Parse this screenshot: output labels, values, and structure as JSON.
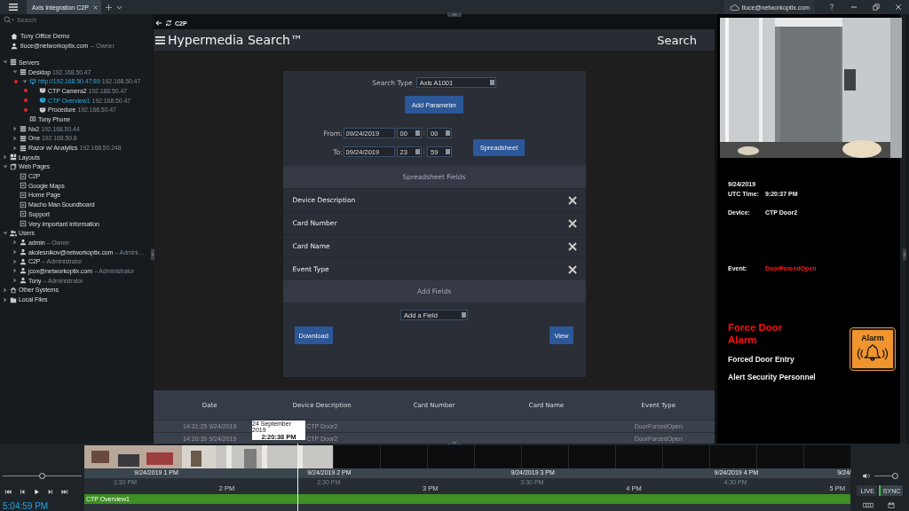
{
  "title_bar": {
    "tab": {
      "label": "Axis Integration C2P",
      "selected": true
    },
    "account": "tluce@networkoptix.com"
  },
  "sidebar": {
    "search_placeholder": "Search",
    "system": "Tony Office Demo",
    "user": {
      "name": "tluce@networkoptix.com",
      "role": "– Owner"
    },
    "tree": [
      {
        "label": "Servers",
        "kind": "servers",
        "expanded": true,
        "selected": false,
        "children": [
          {
            "label": "Desktop",
            "detail": "192.168.50.47",
            "kind": "server",
            "expanded": true,
            "selected": false,
            "children": [
              {
                "label": "http://192.168.50.47:89",
                "detail": "192.168.50.47",
                "kind": "webcam",
                "expanded": true,
                "recording": true,
                "selected": true,
                "children": [
                  {
                    "label": "CTP Camera2",
                    "detail": "192.168.50.47",
                    "kind": "camera",
                    "recording": true,
                    "selected": false
                  },
                  {
                    "label": "CTP Overview1",
                    "detail": "192.168.50.47",
                    "kind": "camera",
                    "recording": true,
                    "selected": true
                  },
                  {
                    "label": "Procedure",
                    "detail": "192.168.50.47",
                    "kind": "camera",
                    "recording": true,
                    "selected": false
                  }
                ]
              },
              {
                "label": "Tony Phone",
                "kind": "phone",
                "recording": false,
                "selected": false
              }
            ]
          },
          {
            "label": "Nx2",
            "detail": "192.168.50.44",
            "kind": "server",
            "expanded": false,
            "selected": false
          },
          {
            "label": "One",
            "detail": "192.168.50.8",
            "kind": "server",
            "expanded": false,
            "selected": false
          },
          {
            "label": "Razor w/ Analytics",
            "detail": "192.168.50.248",
            "kind": "server",
            "expanded": false,
            "selected": false
          }
        ]
      },
      {
        "label": "Layouts",
        "kind": "layouts",
        "expanded": false,
        "selected": false
      },
      {
        "label": "Web Pages",
        "kind": "webpages",
        "expanded": true,
        "selected": false,
        "children": [
          {
            "label": "C2P",
            "kind": "webpage",
            "selected": false
          },
          {
            "label": "Google Maps",
            "kind": "webpage",
            "selected": false
          },
          {
            "label": "Home Page",
            "kind": "webpage",
            "selected": false
          },
          {
            "label": "Macho Man Soundboard",
            "kind": "webpage",
            "selected": false
          },
          {
            "label": "Support",
            "kind": "webpage",
            "selected": false
          },
          {
            "label": "Very Important Information",
            "kind": "webpage",
            "selected": false
          }
        ]
      },
      {
        "label": "Users",
        "kind": "users",
        "expanded": true,
        "selected": false,
        "children": [
          {
            "label": "admin",
            "detail": "– Owner",
            "kind": "user",
            "expanded": false,
            "selected": false
          },
          {
            "label": "akolesnikov@networkoptix.com",
            "detail": "– Admini…",
            "kind": "user",
            "expanded": false,
            "selected": false
          },
          {
            "label": "C2P",
            "detail": "– Administrator",
            "kind": "user",
            "expanded": false,
            "selected": false
          },
          {
            "label": "jcox@networkoptix.com",
            "detail": "– Administrator",
            "kind": "user",
            "expanded": false,
            "selected": false
          },
          {
            "label": "Tony",
            "detail": "– Administrator",
            "kind": "user",
            "expanded": false,
            "selected": false
          }
        ]
      },
      {
        "label": "Other Systems",
        "kind": "systems",
        "expanded": false,
        "selected": false
      },
      {
        "label": "Local Files",
        "kind": "folder",
        "expanded": false,
        "selected": false
      }
    ]
  },
  "web_page": {
    "name": "C2P",
    "title": "Hypermedia Search™",
    "nav_label": "Search",
    "form": {
      "search_type_label": "Search Type",
      "search_type": "Axis A1001",
      "add_parameter": "Add Parameter",
      "ranges": [
        {
          "label": "From:",
          "date": "09/24/2019",
          "hour": "00",
          "separator": ":",
          "minute": "00"
        },
        {
          "label": "To:",
          "date": "09/24/2019",
          "hour": "23",
          "separator": ":",
          "minute": "59"
        }
      ],
      "spreadsheet_button": "Spreadsheet",
      "fields_heading": "Spreadsheet Fields",
      "fields": [
        "Device Description",
        "Card Number",
        "Card Name",
        "Event Type"
      ],
      "add_heading": "Add Fields",
      "add_field": "Add a Field",
      "download": "Download",
      "view": "View"
    },
    "table": {
      "columns": [
        "Date",
        "Device Description",
        "Card Number",
        "Card Name",
        "Event Type"
      ],
      "rows": [
        [
          "14:31:25 9/24/2019",
          "CTP Door2",
          "",
          "",
          "DoorForcedOpen"
        ],
        [
          "14:20:39 9/24/2019",
          "CTP Door2",
          "",
          "",
          "DoorForcedOpen"
        ]
      ]
    }
  },
  "event_panel": {
    "date": "9/24/2019",
    "fields": [
      {
        "label": "UTC Time:",
        "value": "9:20:37 PM",
        "alert": false
      },
      {
        "label": "Device:",
        "value": "CTP Door2",
        "alert": false
      },
      {
        "label": "Event:",
        "value": "DoorForcedOpen",
        "alert": true
      }
    ],
    "heading": "Force Door Alarm",
    "lines": [
      "Forced Door Entry",
      "Alert Security Personnel"
    ],
    "sign": "Alarm"
  },
  "timeline": {
    "speed": {
      "level": 0.5
    },
    "time": "5:04:59 PM",
    "dates": [
      "9/24/2019 1 PM",
      "9/24/2019 2 PM",
      "9/24/2019 3 PM",
      "9/24/2019 4 PM",
      "9/24/"
    ],
    "ticks": [
      {
        "label": "1:30 PM",
        "major": false
      },
      {
        "label": "2 PM",
        "major": true
      },
      {
        "label": "2:30 PM",
        "major": false
      },
      {
        "label": "3 PM",
        "major": true
      },
      {
        "label": "3:30 PM",
        "major": false
      },
      {
        "label": "4 PM",
        "major": true
      },
      {
        "label": "4:30 PM",
        "major": false
      },
      {
        "label": "5 PM",
        "major": true
      }
    ],
    "track": "CTP Overview1",
    "volume": {
      "level": 0.95
    },
    "live": {
      "label": "LIVE",
      "on": false
    },
    "sync": {
      "label": "SYNC",
      "on": true
    },
    "tooltip": {
      "date": "24 September 2019",
      "time": "2:20:38 PM"
    }
  }
}
